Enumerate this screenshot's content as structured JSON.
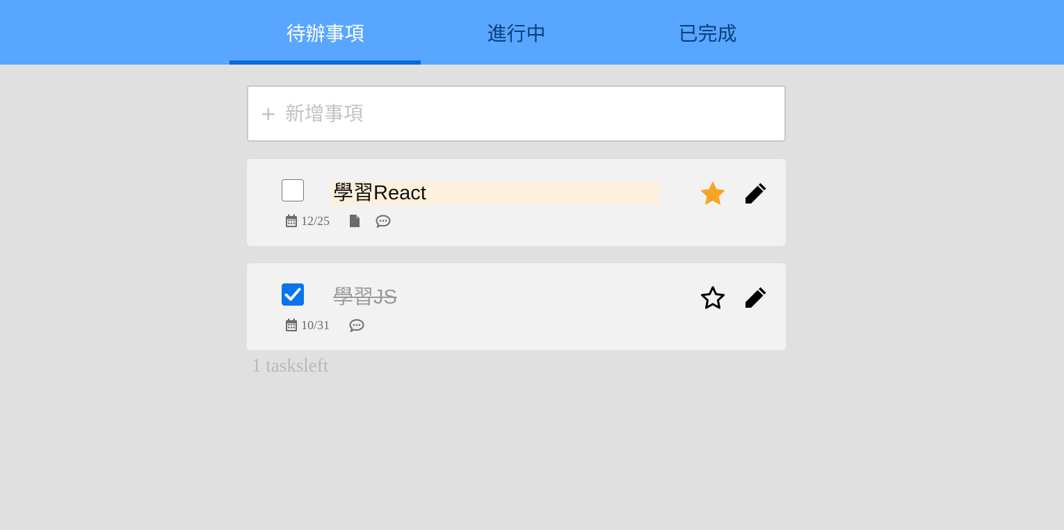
{
  "tabs": [
    {
      "label": "待辦事項",
      "active": true
    },
    {
      "label": "進行中",
      "active": false
    },
    {
      "label": "已完成",
      "active": false
    }
  ],
  "add_task": {
    "icon": "plus-icon",
    "plus_glyph": "+",
    "placeholder": "新增事項"
  },
  "tasks": [
    {
      "title": "學習React",
      "completed": false,
      "starred": true,
      "highlighted": true,
      "date": "12/25",
      "icons": [
        "calendar-icon",
        "file-icon",
        "comment-icon"
      ]
    },
    {
      "title": "學習JS",
      "completed": true,
      "starred": false,
      "highlighted": false,
      "date": "10/31",
      "icons": [
        "calendar-icon",
        "comment-icon"
      ]
    }
  ],
  "footer": {
    "tasks_left": "1 tasksleft"
  },
  "colors": {
    "header_bg": "#58a6ff",
    "active_tab_indicator": "#0a6ad8",
    "page_bg": "#e0e0e0",
    "card_bg": "#f2f2f2",
    "highlight_bg": "#fdf0dc",
    "star_active": "#f5a623",
    "checkbox_checked": "#0a74ec"
  }
}
